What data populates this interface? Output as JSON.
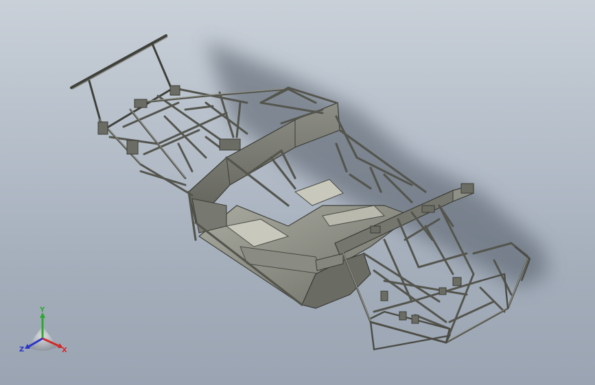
{
  "viewport": {
    "background_top": "#c9d0d8",
    "background_bottom": "#9aa4b2",
    "model": {
      "frame_color": "#5e5f57",
      "panel_color": "#7c7d74",
      "floor_light_color": "#bdbdb2",
      "shadow_color": "#505863"
    }
  },
  "triad": {
    "y_label": "Y",
    "z_label": "Z",
    "x_label": "X",
    "y_color": "#2da832",
    "z_color": "#2a34c8",
    "x_color": "#d22a2a"
  }
}
